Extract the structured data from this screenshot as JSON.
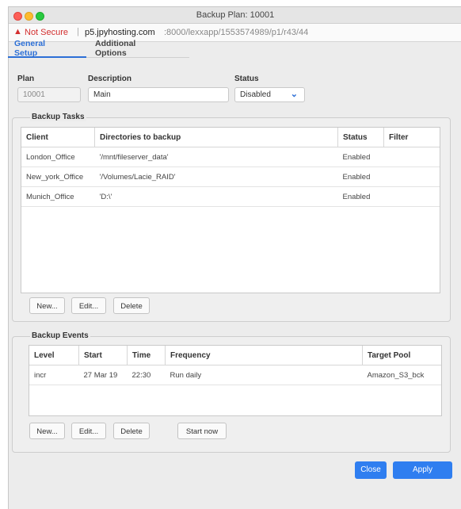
{
  "window": {
    "title": "Backup Plan: 10001"
  },
  "urlbar": {
    "warning_icon": "warning-triangle",
    "not_secure": "Not Secure",
    "separator": "|",
    "host": "p5.jpyhosting.com",
    "path": ":8000/lexxapp/1553574989/p1/r43/44"
  },
  "tabs": [
    {
      "label": "General Setup",
      "active": true
    },
    {
      "label": "Additional Options",
      "active": false
    }
  ],
  "form": {
    "plan_label": "Plan",
    "plan_value": "10001",
    "description_label": "Description",
    "description_value": "Main",
    "status_label": "Status",
    "status_value": "Disabled"
  },
  "backup_tasks": {
    "title": "Backup Tasks",
    "columns": [
      "Client",
      "Directories to backup",
      "Status",
      "Filter"
    ],
    "rows": [
      [
        "London_Office",
        "'/mnt/fileserver_data'",
        "Enabled",
        ""
      ],
      [
        "New_york_Office",
        "'/Volumes/Lacie_RAID'",
        "Enabled",
        ""
      ],
      [
        "Munich_Office",
        "'D:\\'",
        "Enabled",
        ""
      ]
    ],
    "buttons": {
      "new": "New...",
      "edit": "Edit...",
      "delete": "Delete"
    }
  },
  "backup_events": {
    "title": "Backup Events",
    "columns": [
      "Level",
      "Start",
      "Time",
      "Frequency",
      "Target Pool"
    ],
    "rows": [
      [
        "incr",
        "27 Mar 19",
        "22:30",
        "Run daily",
        "Amazon_S3_bck"
      ]
    ],
    "buttons": {
      "new": "New...",
      "edit": "Edit...",
      "delete": "Delete",
      "start_now": "Start now"
    }
  },
  "footer": {
    "close": "Close",
    "apply": "Apply"
  },
  "colors": {
    "accent": "#2c6fd6",
    "primary_button": "#2f7ef0",
    "warning": "#d32f2f"
  }
}
